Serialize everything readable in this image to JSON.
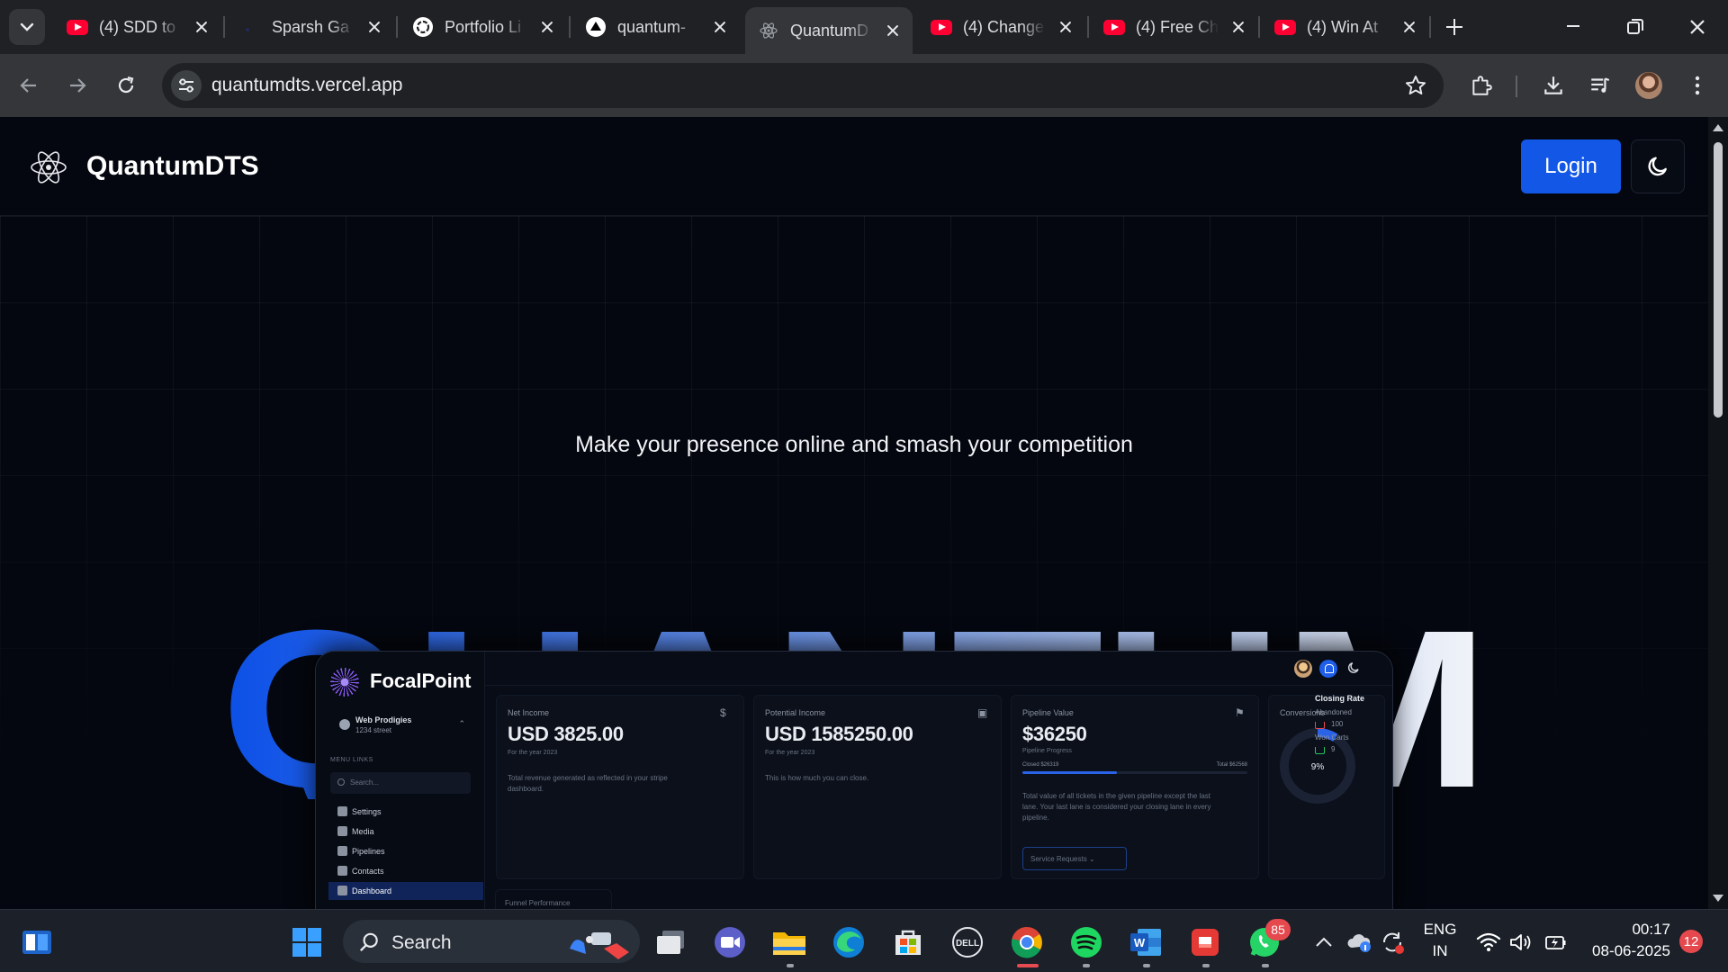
{
  "browser": {
    "tabs": [
      {
        "title": "(4) SDD to",
        "favicon": "youtube-icon",
        "active": false
      },
      {
        "title": "Sparsh Ga",
        "favicon": "blank-icon",
        "active": false
      },
      {
        "title": "Portfolio Li",
        "favicon": "openai-icon",
        "active": false
      },
      {
        "title": "quantum-",
        "favicon": "vercel-icon",
        "active": false
      },
      {
        "title": "QuantumD",
        "favicon": "atom-icon",
        "active": true
      },
      {
        "title": "(4) Change",
        "favicon": "youtube-icon",
        "active": false
      },
      {
        "title": "(4) Free Ch",
        "favicon": "youtube-icon",
        "active": false
      },
      {
        "title": "(4) Win At",
        "favicon": "youtube-icon",
        "active": false
      }
    ],
    "url": "quantumdts.vercel.app"
  },
  "site": {
    "brand": "QuantumDTS",
    "login_label": "Login",
    "tagline": "Make your presence online and smash your competition",
    "hero_word": "QUANTUM",
    "accent": "#1357e6"
  },
  "dashboard": {
    "brand": "FocalPoint",
    "account_name": "Web Prodigies",
    "account_address": "1234 street",
    "menu_label": "MENU LINKS",
    "search_placeholder": "Search...",
    "nav": [
      "Settings",
      "Media",
      "Pipelines",
      "Contacts",
      "Dashboard"
    ],
    "active_nav": "Dashboard",
    "cards": {
      "net_income": {
        "label": "Net Income",
        "value": "USD 3825.00",
        "sub": "For the year 2023",
        "desc": "Total revenue generated as reflected in your stripe dashboard."
      },
      "potential_income": {
        "label": "Potential Income",
        "value": "USD 1585250.00",
        "sub": "For the year 2023",
        "desc": "This is how much you can close."
      },
      "pipeline": {
        "label": "Pipeline Value",
        "value": "$36250",
        "progress_label": "Pipeline Progress",
        "closed": "Closed $26319",
        "total": "Total $62568",
        "progress": 0.42,
        "desc": "Total value of all tickets in the given pipeline except the last lane. Your last lane is considered your closing lane in every pipeline.",
        "select": "Service Requests"
      },
      "conversions": {
        "label": "Conversions",
        "percent": "9%",
        "closing_rate": "Closing Rate",
        "abandoned_label": "Abandoned",
        "abandoned_count": "100",
        "won_label": "Won Carts",
        "won_count": "9"
      }
    },
    "funnel_label": "Funnel Performance"
  },
  "taskbar": {
    "search_label": "Search",
    "whatsapp_badge": "85",
    "language": "ENG",
    "region": "IN",
    "time": "00:17",
    "date": "08-06-2025",
    "notifications": "12"
  }
}
